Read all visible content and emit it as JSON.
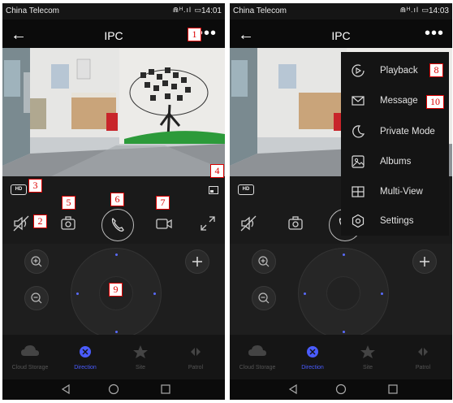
{
  "screens": [
    {
      "status": {
        "carrier": "China Telecom",
        "time": "14:01",
        "icons": "⋒ᴴ.ıl ▭ "
      },
      "appbar": {
        "back": "←",
        "title": "IPC",
        "more": "•••"
      },
      "hd_label": "HD",
      "tabs": [
        {
          "label": "Cloud Storage"
        },
        {
          "label": "Direction"
        },
        {
          "label": "Site"
        },
        {
          "label": "Patrol"
        }
      ],
      "annotations": [
        "1",
        "2",
        "3",
        "4",
        "5",
        "6",
        "7",
        "9"
      ]
    },
    {
      "status": {
        "carrier": "China Telecom",
        "time": "14:03",
        "icons": "⋒ᴴ.ıl ▭ "
      },
      "appbar": {
        "back": "←",
        "title": "IPC",
        "more": "•••"
      },
      "hd_label": "HD",
      "tabs": [
        {
          "label": "Cloud Storage"
        },
        {
          "label": "Direction"
        },
        {
          "label": "Site"
        },
        {
          "label": "Patrol"
        }
      ],
      "menu": {
        "items": [
          {
            "label": "Playback",
            "icon": "playback-icon"
          },
          {
            "label": "Message",
            "icon": "message-icon"
          },
          {
            "label": "Private Mode",
            "icon": "moon-icon"
          },
          {
            "label": "Albums",
            "icon": "album-icon"
          },
          {
            "label": "Multi-View",
            "icon": "multi-view-icon"
          },
          {
            "label": "Settings",
            "icon": "settings-icon"
          }
        ]
      },
      "annotations": [
        "8",
        "10"
      ]
    }
  ],
  "colors": {
    "accent": "#4a5cff",
    "annotation": "#dd0000",
    "background": "#0b0b0b"
  }
}
